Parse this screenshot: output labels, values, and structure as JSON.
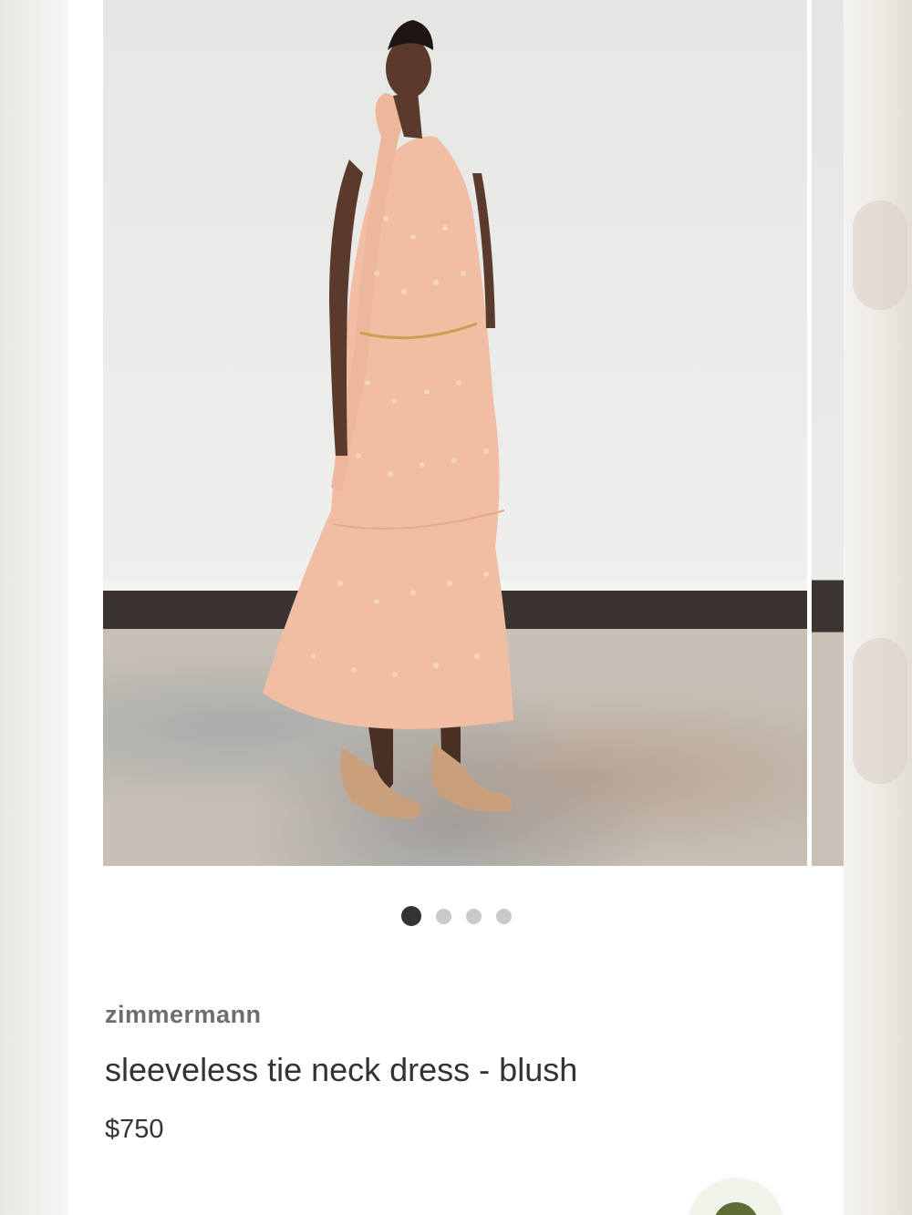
{
  "product": {
    "brand": "zimmermann",
    "name": "sleeveless tie neck dress - blush",
    "price": "$750"
  },
  "gallery": {
    "image_count": 4,
    "active_index": 0,
    "image_alt": "Model wearing blush sleeveless tie neck dress"
  },
  "colors": {
    "dress": "#f1bea3",
    "active_dot": "#333333",
    "inactive_dot": "#c9c9c9",
    "fab_green": "#5e6d35"
  }
}
